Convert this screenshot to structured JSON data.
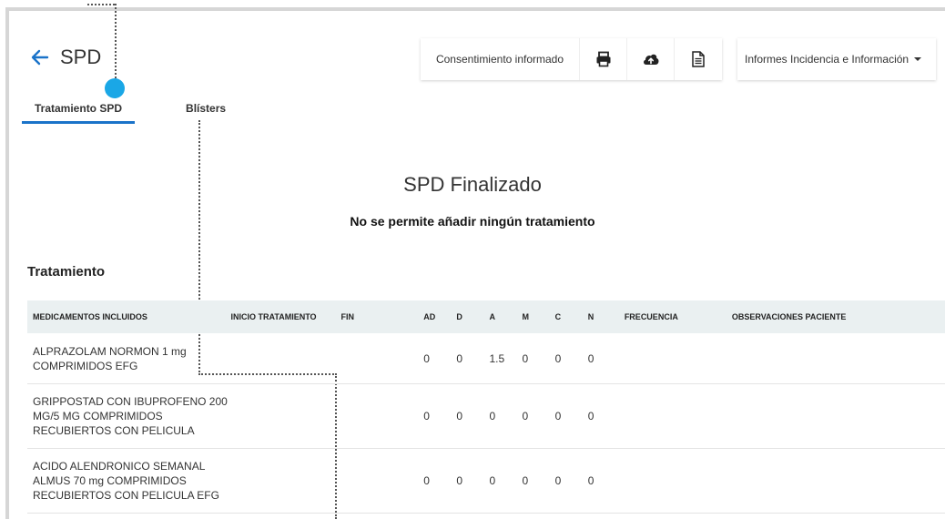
{
  "header": {
    "title": "SPD",
    "back_icon": "arrow-left-icon"
  },
  "tabs": [
    {
      "label": "Tratamiento SPD",
      "active": true
    },
    {
      "label": "Blísters",
      "active": false
    }
  ],
  "toolbar": {
    "consent_label": "Consentimiento informado",
    "icons": [
      "print-icon",
      "cloud-upload-icon",
      "document-icon"
    ]
  },
  "reports_menu": {
    "label": "Informes Incidencia e Información"
  },
  "status": {
    "heading": "SPD Finalizado",
    "message": "No se permite añadir ningún tratamiento"
  },
  "section": {
    "title": "Tratamiento"
  },
  "table": {
    "columns": [
      "MEDICAMENTOS INCLUIDOS",
      "INICIO TRATAMIENTO",
      "FIN",
      "AD",
      "D",
      "A",
      "M",
      "C",
      "N",
      "FRECUENCIA",
      "OBSERVACIONES PACIENTE"
    ],
    "rows": [
      {
        "med": "ALPRAZOLAM NORMON 1 mg COMPRIMIDOS EFG",
        "inicio": "",
        "fin": "",
        "ad": "0",
        "d": "0",
        "a": "1.5",
        "m": "0",
        "c": "0",
        "n": "0",
        "frecuencia": "",
        "observaciones": ""
      },
      {
        "med": "GRIPPOSTAD CON IBUPROFENO 200 MG/5 MG COMPRIMIDOS RECUBIERTOS CON PELICULA",
        "inicio": "",
        "fin": "",
        "ad": "0",
        "d": "0",
        "a": "0",
        "m": "0",
        "c": "0",
        "n": "0",
        "frecuencia": "",
        "observaciones": ""
      },
      {
        "med": "ACIDO ALENDRONICO SEMANAL ALMUS 70 mg COMPRIMIDOS RECUBIERTOS CON PELICULA EFG",
        "inicio": "",
        "fin": "",
        "ad": "0",
        "d": "0",
        "a": "0",
        "m": "0",
        "c": "0",
        "n": "0",
        "frecuencia": "",
        "observaciones": ""
      }
    ]
  },
  "colors": {
    "accent": "#1a73c9",
    "marker": "#1aa7e6",
    "table_header_bg": "#eaf0f1"
  }
}
